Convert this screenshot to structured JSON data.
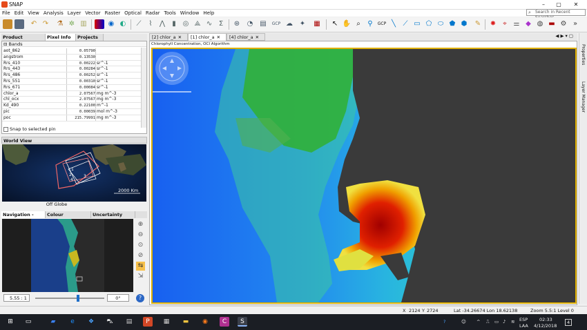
{
  "window": {
    "title": "SNAP",
    "minimize": "–",
    "maximize": "▢",
    "close": "✕"
  },
  "menu": [
    "File",
    "Edit",
    "View",
    "Analysis",
    "Layer",
    "Vector",
    "Raster",
    "Optical",
    "Radar",
    "Tools",
    "Window",
    "Help"
  ],
  "search": {
    "placeholder": "Search in Recent Searches"
  },
  "left_tabs": [
    "Product Explorer",
    "Pixel Info",
    "Projects"
  ],
  "pixel_info": {
    "section": "Bands",
    "rows": [
      {
        "name": "aot_862",
        "value": "0.05790",
        "unit": ""
      },
      {
        "name": "angstrom",
        "value": "0.13530",
        "unit": ""
      },
      {
        "name": "Rrs_410",
        "value": "0.00222",
        "unit": "sr^-1"
      },
      {
        "name": "Rrs_443",
        "value": "0.00284",
        "unit": "sr^-1"
      },
      {
        "name": "Rrs_486",
        "value": "0.00252",
        "unit": "sr^-1"
      },
      {
        "name": "Rrs_551",
        "value": "0.00310",
        "unit": "sr^-1"
      },
      {
        "name": "Rrs_671",
        "value": "0.00084",
        "unit": "sr^-1"
      },
      {
        "name": "chlor_a",
        "value": "2.07567",
        "unit": "mg m^-3"
      },
      {
        "name": "chl_ocx",
        "value": "2.07567",
        "unit": "mg m^-3"
      },
      {
        "name": "Kd_490",
        "value": "0.22100",
        "unit": "m^-1"
      },
      {
        "name": "pic",
        "value": "0.00039",
        "unit": "mol m^-3"
      },
      {
        "name": "poc",
        "value": "215.79991",
        "unit": "mg m^-3"
      }
    ],
    "snap_label": "Snap to selected pin"
  },
  "world_view": {
    "title": "World View",
    "scale": "2000 Km",
    "caption": "Off Globe",
    "markers": [
      "1",
      "2",
      "4",
      "3"
    ]
  },
  "nav_tabs": [
    "Navigation - [1...",
    "Colour Manipulati...",
    "Uncertainty Visua..."
  ],
  "zoom": {
    "scale": "5.55 : 1",
    "rotation": "0°",
    "help": "?"
  },
  "editor_tabs": [
    "[2] chlor_a",
    "[1] chlor_a",
    "[4] chlor_a"
  ],
  "editor_nav": "◀ ▶ ▾ ▢",
  "canvas_caption": "Chlorophyll Concentration, OCI Algorithm",
  "right_labels": [
    "Properties",
    "Layer Manager"
  ],
  "status": {
    "x": "X",
    "x_val": "2124",
    "y": "Y",
    "y_val": "2724",
    "coords": "Lat -34.26674 Lon 18.62138",
    "zoom": "Zoom 5.5:1 Level 0"
  },
  "tray": {
    "lang1": "ESP",
    "lang2": "LAA",
    "time": "02:33",
    "date": "4/12/2018",
    "notif": "4"
  },
  "colors": {
    "accent": "#e0b000",
    "land": "#3a3a3a",
    "ocean_low": "#1e6ef0",
    "ocean_mid": "#2fd6b8",
    "bloom_high": "#c00000"
  }
}
